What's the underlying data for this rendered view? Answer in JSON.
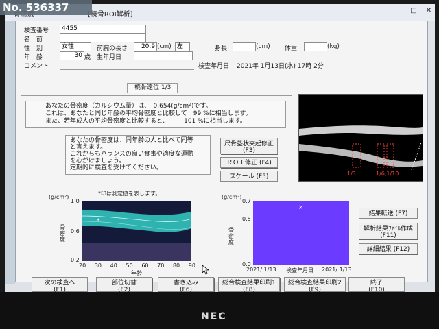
{
  "watermark": "No. 536337",
  "window": {
    "title_left": "骨密度",
    "title": "[橈骨ROI解析]"
  },
  "patient": {
    "exam_number_label": "検査番号",
    "exam_number": "4455",
    "name_label": "名　前",
    "sex_label": "性　別",
    "sex": "女性",
    "forearm_label": "前腕の長さ",
    "forearm_value": "20.9",
    "forearm_unit": "(cm)",
    "forearm_side": "左",
    "height_label": "身長",
    "height_unit": "(cm)",
    "weight_label": "体重",
    "weight_unit": "(kg)",
    "age_label": "年　齢",
    "age": "30",
    "age_unit": "歳",
    "birth_label": "生年月日",
    "exam_date_label": "検査年月日",
    "exam_date": "2021年 1月13日(水) 17時 2分",
    "comment_label": "コメント"
  },
  "site": {
    "label": "橈骨遠位 1/3"
  },
  "result": {
    "line1": "あなたの骨密度（カルシウム量）は、　0.654(g/cm²)です。",
    "line2": "これは、あなたと同じ年齢の平均骨密度と比較して　99 %に相当します。",
    "line3": "また、若年成人の平均骨密度と比較すると、　　　101 %に相当します。"
  },
  "advice": {
    "line1": "あなたの骨密度は、同年齢の人と比べて同等",
    "line2": "と言えます。",
    "line3": "これからもバランスの良い食事や適度な運動",
    "line4": "を心がけましょう。",
    "line5": "定期的に検査を受けてください。"
  },
  "buttons": {
    "ulna_fix": "尺骨茎状突起修正",
    "ulna_fix_key": "(F3)",
    "roi_fix": "ＲＯＩ修正 (F4)",
    "scale": "スケール (F5)",
    "transfer": "結果転送 (F7)",
    "analysis_file": "解析結果ﾌｧｲﾙ作成",
    "analysis_file_key": "(F11)",
    "details": "詳細結果 (F12)"
  },
  "xray": {
    "label_13": "1/3",
    "label_ud": "1/6,1/10"
  },
  "graph1": {
    "unit": "(g/cm²)",
    "note": "*印は測定値を表します。",
    "y_max": "1.0",
    "y_mid": "0.6",
    "y_min": "0.2",
    "ylabel": "骨密度",
    "xticks": [
      "20",
      "30",
      "40",
      "50",
      "60",
      "70",
      "80",
      "90"
    ],
    "xlabel": "年齢",
    "marker": "*"
  },
  "graph2": {
    "unit": "(g/cm²)",
    "y_max": "0.7",
    "y_mid": "0.5",
    "y_min": "0.0",
    "ylabel": "骨密度",
    "x_left": "2021/ 1/13",
    "x_mid": "検査年月日",
    "x_right": "2021/ 1/13",
    "marker": "×"
  },
  "fkeys": [
    {
      "label": "次の検査へ",
      "key": "(F1)"
    },
    {
      "label": "部位切替",
      "key": "(F2)"
    },
    {
      "label": "書き込み",
      "key": "(F6)"
    },
    {
      "label": "総合検査結果印刷1",
      "key": "(F8)"
    },
    {
      "label": "総合検査結果印刷2",
      "key": "(F9)"
    },
    {
      "label": "終了",
      "key": "(F10)"
    }
  ],
  "monitor_brand": "NEC",
  "colors": {
    "xray_bg": "#000000",
    "graph1_band": "#2fb3b0",
    "graph1_bg": "#141a3a",
    "graph2_fill": "#6b3cff",
    "xray_roi": "#ff4030"
  }
}
